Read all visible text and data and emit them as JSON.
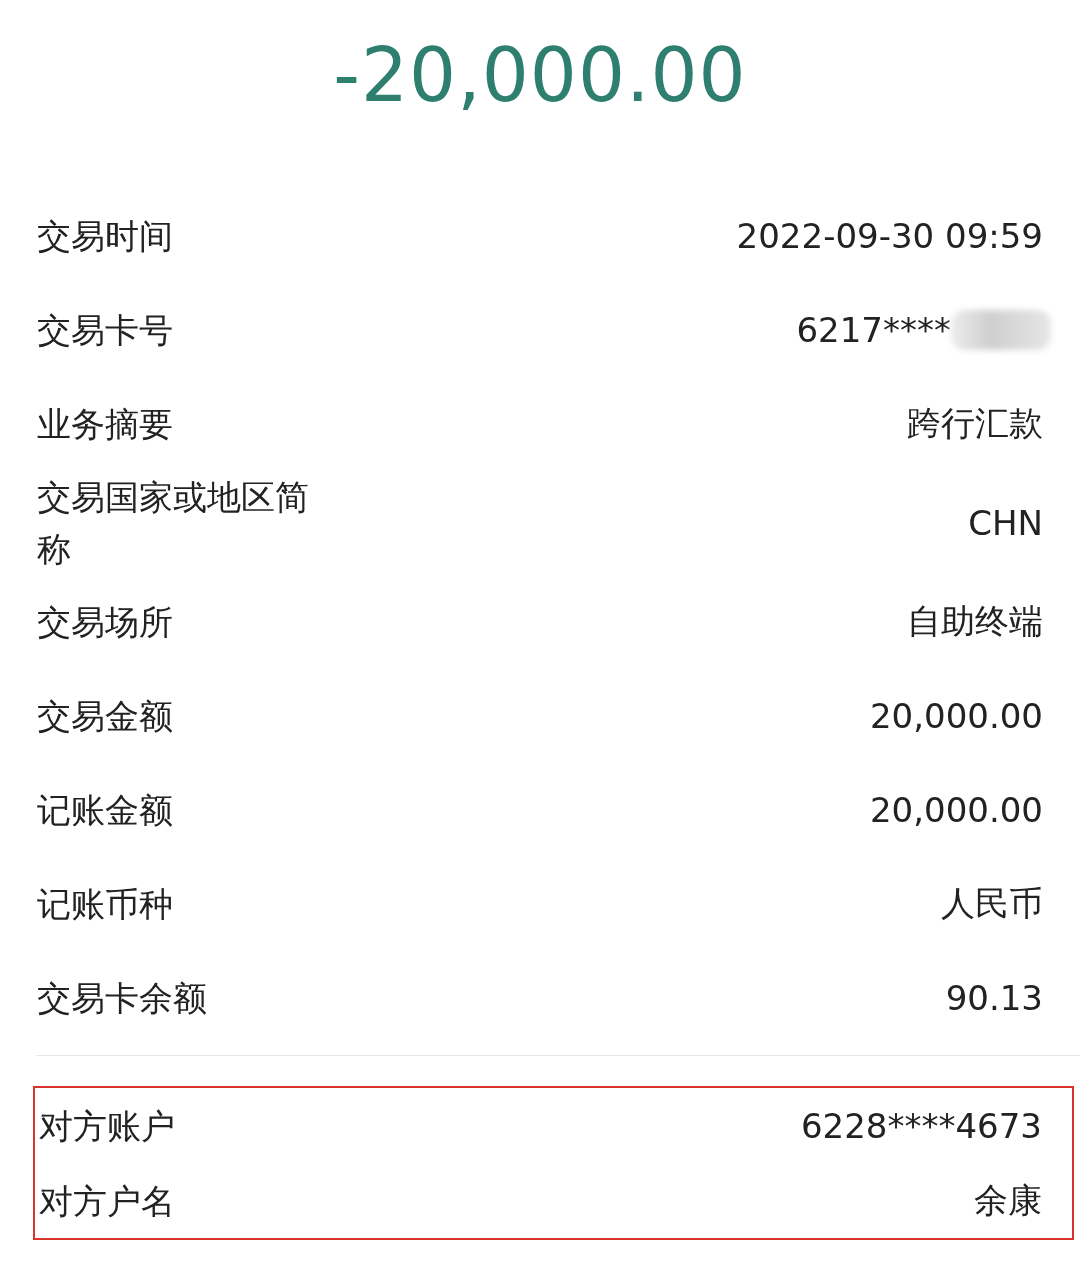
{
  "amount": "-20,000.00",
  "details": [
    {
      "label": "交易时间",
      "value": "2022-09-30 09:59",
      "redacted": false
    },
    {
      "label": "交易卡号",
      "value": "6217****",
      "redacted": true
    },
    {
      "label": "业务摘要",
      "value": "跨行汇款",
      "redacted": false
    },
    {
      "label": "交易国家或地区简称",
      "value": "CHN",
      "redacted": false
    },
    {
      "label": "交易场所",
      "value": "自助终端",
      "redacted": false
    },
    {
      "label": "交易金额",
      "value": "20,000.00",
      "redacted": false
    },
    {
      "label": "记账金额",
      "value": "20,000.00",
      "redacted": false
    },
    {
      "label": "记账币种",
      "value": "人民币",
      "redacted": false
    },
    {
      "label": "交易卡余额",
      "value": "90.13",
      "redacted": false
    }
  ],
  "counterparty": {
    "highlighted": true,
    "rows": [
      {
        "label": "对方账户",
        "value": "6228****4673"
      },
      {
        "label": "对方户名",
        "value": "余康"
      }
    ]
  }
}
